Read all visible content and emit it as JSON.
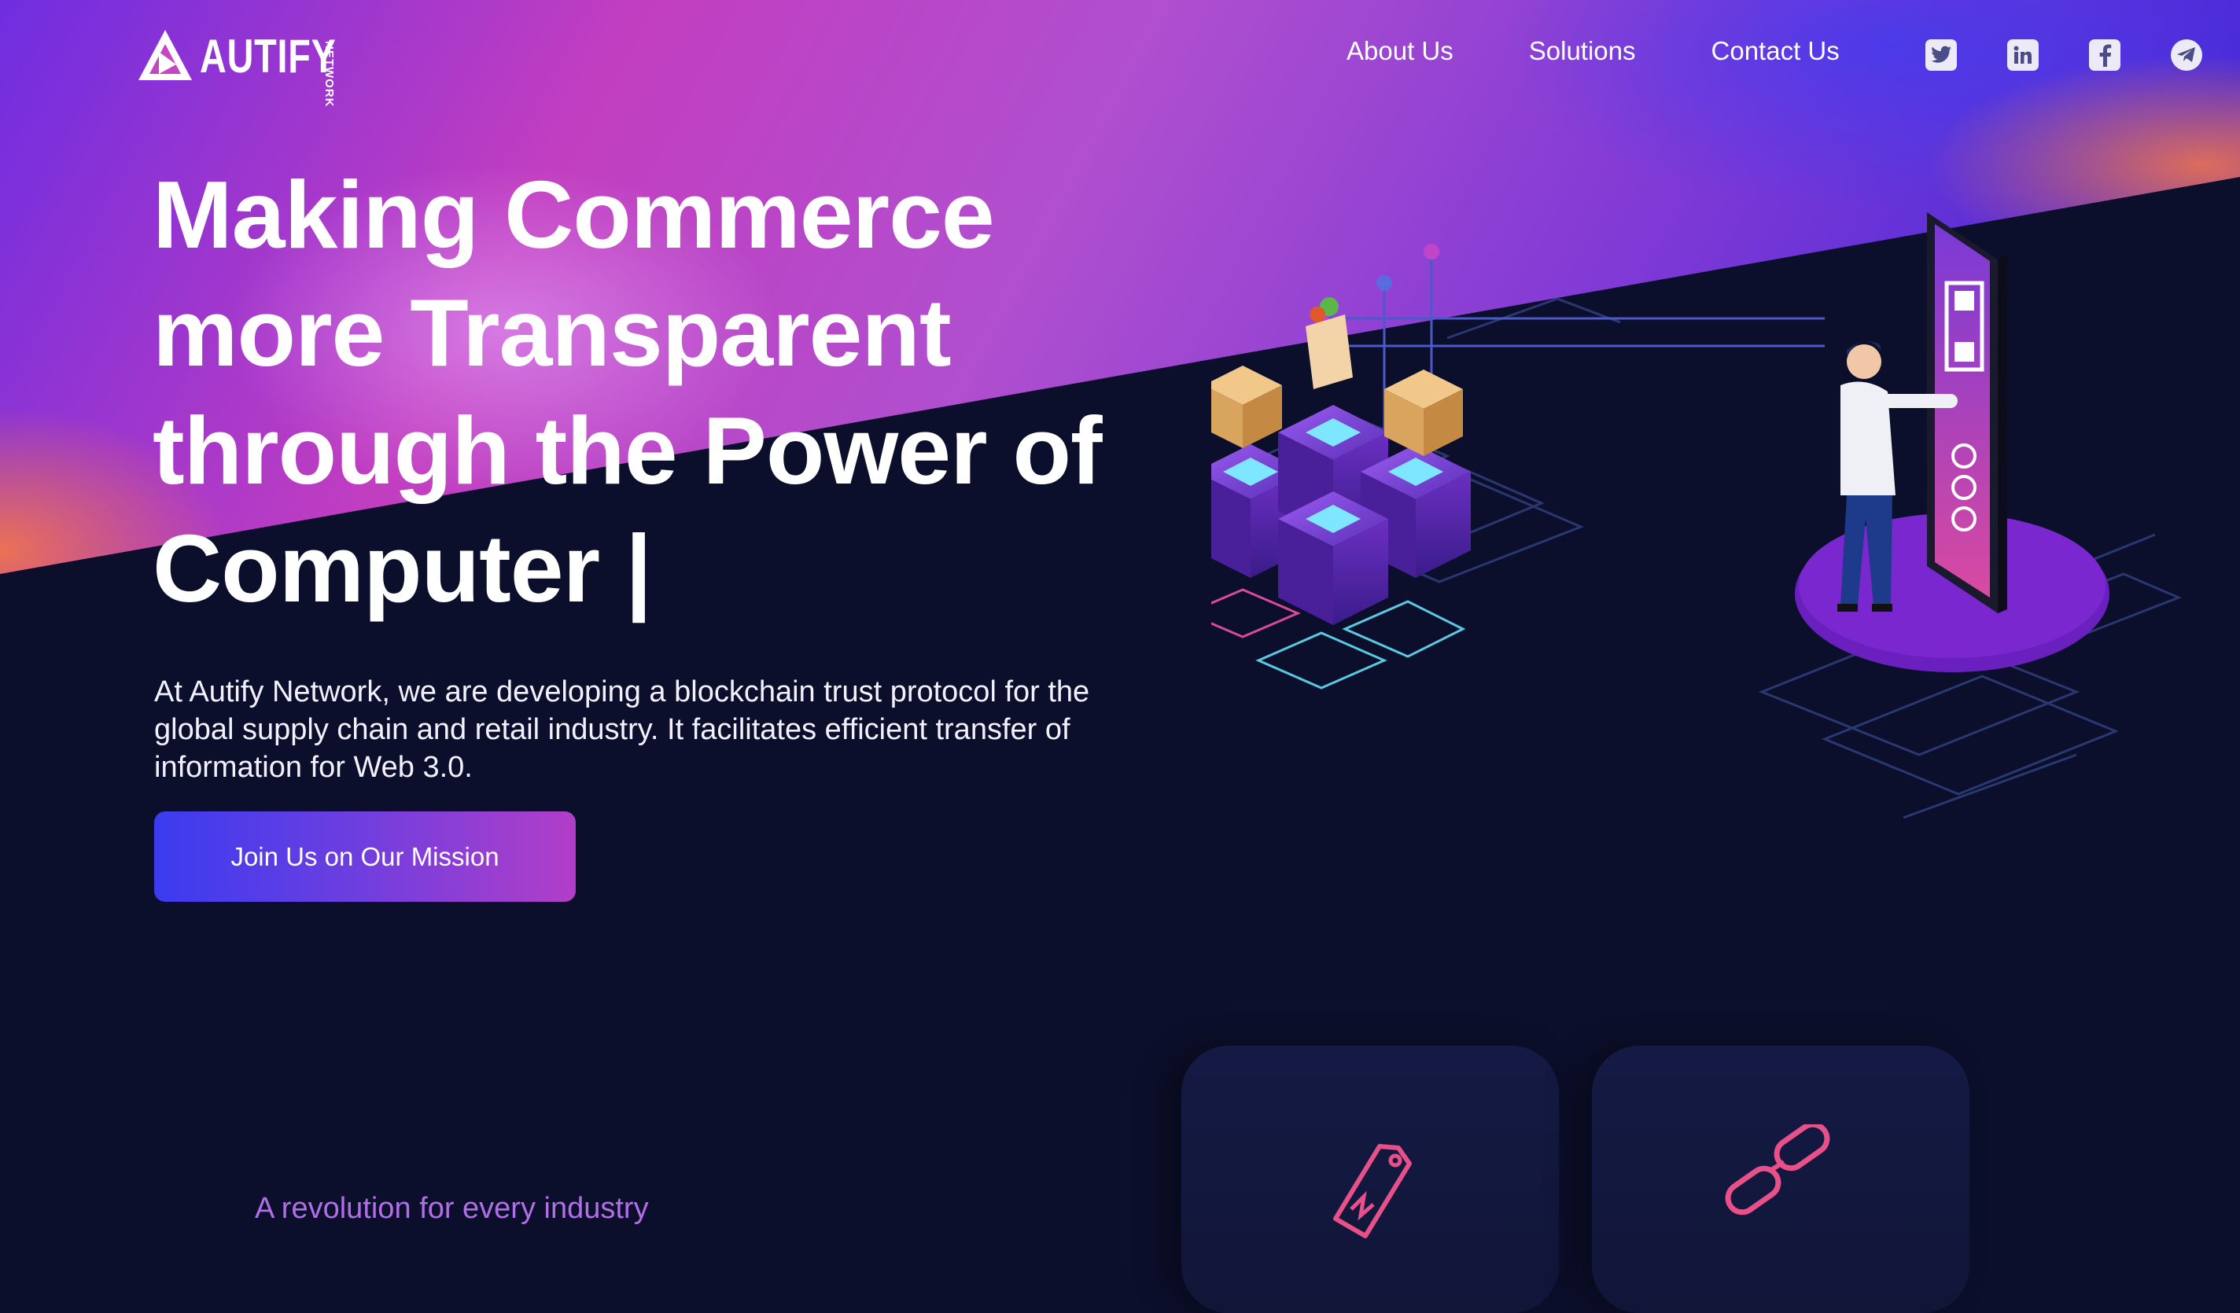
{
  "brand": {
    "name": "AUTIFY",
    "sub": "NETWORK",
    "logo_icon": "autify-logo-icon"
  },
  "nav": {
    "items": [
      "About Us",
      "Solutions",
      "Contact Us"
    ]
  },
  "socials": [
    "twitter-icon",
    "linkedin-icon",
    "facebook-icon",
    "telegram-icon"
  ],
  "hero": {
    "title_lines": [
      "Making Commerce",
      "more Transparent",
      "through the Power of",
      "Computer |"
    ],
    "description": "At Autify Network, we are developing a blockchain trust protocol for the global supply chain and retail industry. It facilitates efficient transfer of information for Web 3.0.",
    "cta_label": "Join Us on Our Mission"
  },
  "section": {
    "tagline": "A revolution for every industry",
    "card_icons": [
      "price-tag-icon",
      "chain-link-icon"
    ]
  },
  "colors": {
    "background": "#0c0f2b",
    "accent_purple": "#b06fe6",
    "accent_pink": "#e8508a",
    "button_start": "#3a3cf0",
    "button_end": "#b23ec8"
  }
}
